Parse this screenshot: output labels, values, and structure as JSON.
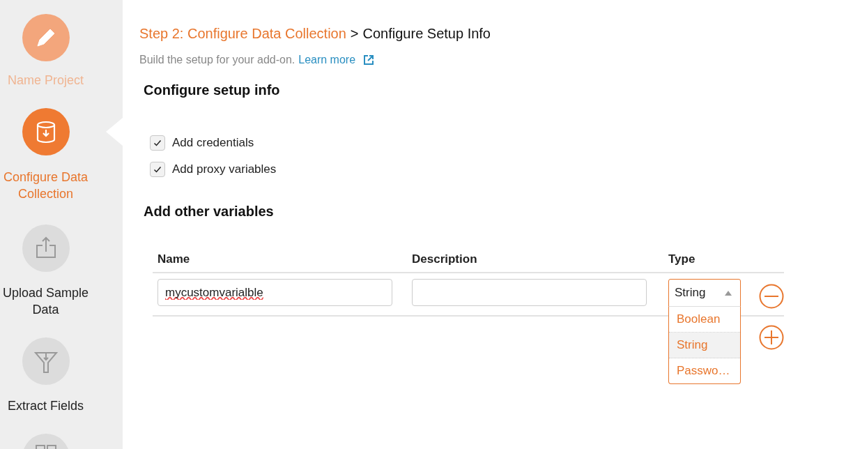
{
  "sidebar": {
    "steps": [
      {
        "label": "Name Project",
        "completed": true,
        "selected": false
      },
      {
        "label": "Configure Data Collection",
        "completed": false,
        "selected": true
      },
      {
        "label": "Upload Sample Data",
        "completed": false,
        "selected": false
      },
      {
        "label": "Extract Fields",
        "completed": false,
        "selected": false
      },
      {
        "completed": false,
        "selected": false
      }
    ]
  },
  "breadcrumb": {
    "step": "Step 2: Configure Data Collection",
    "separator": ">",
    "current": "Configure Setup Info"
  },
  "subtitle": {
    "text": "Build the setup for your add-on.",
    "link": "Learn more"
  },
  "setup": {
    "heading": "Configure setup info",
    "options": [
      {
        "label": "Add credentials",
        "checked": true
      },
      {
        "label": "Add proxy variables",
        "checked": true
      }
    ]
  },
  "variables": {
    "heading": "Add other variables",
    "columns": [
      "Name",
      "Description",
      "Type"
    ],
    "rows": [
      {
        "name": "mycustomvarialble",
        "description": "",
        "type": "String",
        "expanded": true,
        "options": [
          {
            "label": "Boolean",
            "selected": false
          },
          {
            "label": "String",
            "selected": true
          },
          {
            "label": "Passwo…",
            "selected": false
          }
        ]
      }
    ]
  }
}
